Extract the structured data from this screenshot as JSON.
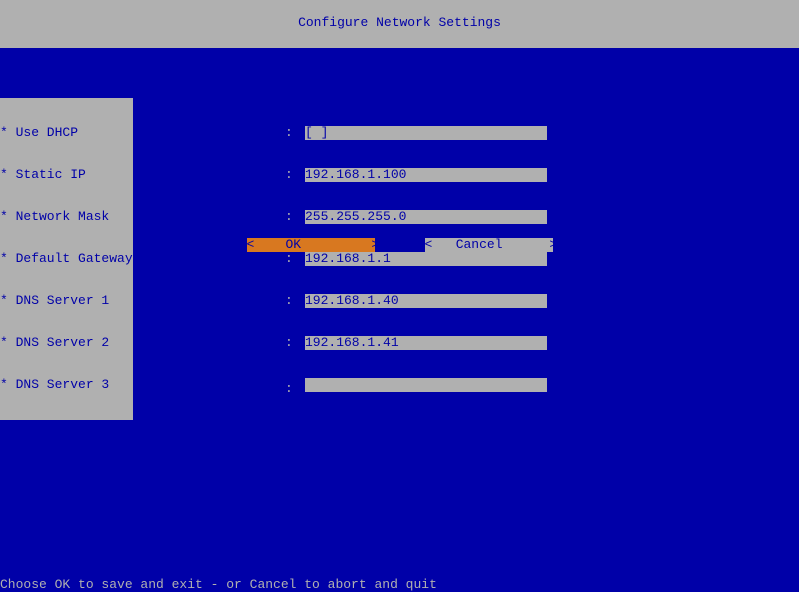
{
  "title": "Configure Network Settings",
  "fields": [
    {
      "label": "* Use DHCP",
      "value": "[ ]"
    },
    {
      "label": "* Static IP",
      "value": "192.168.1.100"
    },
    {
      "label": "* Network Mask",
      "value": "255.255.255.0"
    },
    {
      "label": "* Default Gateway",
      "value": "192.168.1.1"
    },
    {
      "label": "* DNS Server 1",
      "value": "192.168.1.40"
    },
    {
      "label": "* DNS Server 2",
      "value": "192.168.1.41"
    },
    {
      "label": "* DNS Server 3",
      "value": ""
    }
  ],
  "buttons": {
    "ok": "<    OK         >",
    "cancel": "<   Cancel      >"
  },
  "footer": "Choose OK to save and exit - or Cancel to abort and quit"
}
